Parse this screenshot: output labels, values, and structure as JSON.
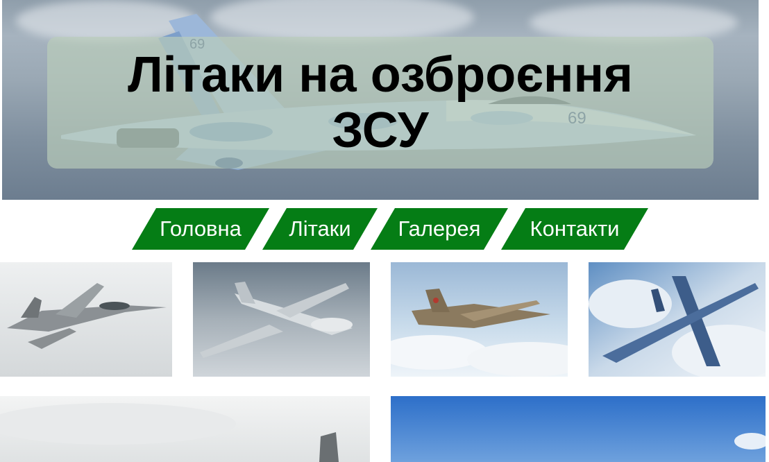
{
  "header": {
    "title": "Літаки на озброєння ЗСУ"
  },
  "nav": {
    "items": [
      {
        "label": "Головна"
      },
      {
        "label": "Літаки"
      },
      {
        "label": "Галерея"
      },
      {
        "label": "Контакти"
      }
    ]
  },
  "gallery": {
    "images": [
      {
        "name": "mig-29-photo"
      },
      {
        "name": "su-24-photo"
      },
      {
        "name": "su-25-photo"
      },
      {
        "name": "su-27-photo"
      },
      {
        "name": "aircraft-photo-5"
      },
      {
        "name": "aircraft-photo-6"
      }
    ]
  },
  "colors": {
    "nav_bg": "#057d15",
    "nav_text": "#ffffff",
    "banner_bg": "rgba(185,205,185,0.68)"
  }
}
